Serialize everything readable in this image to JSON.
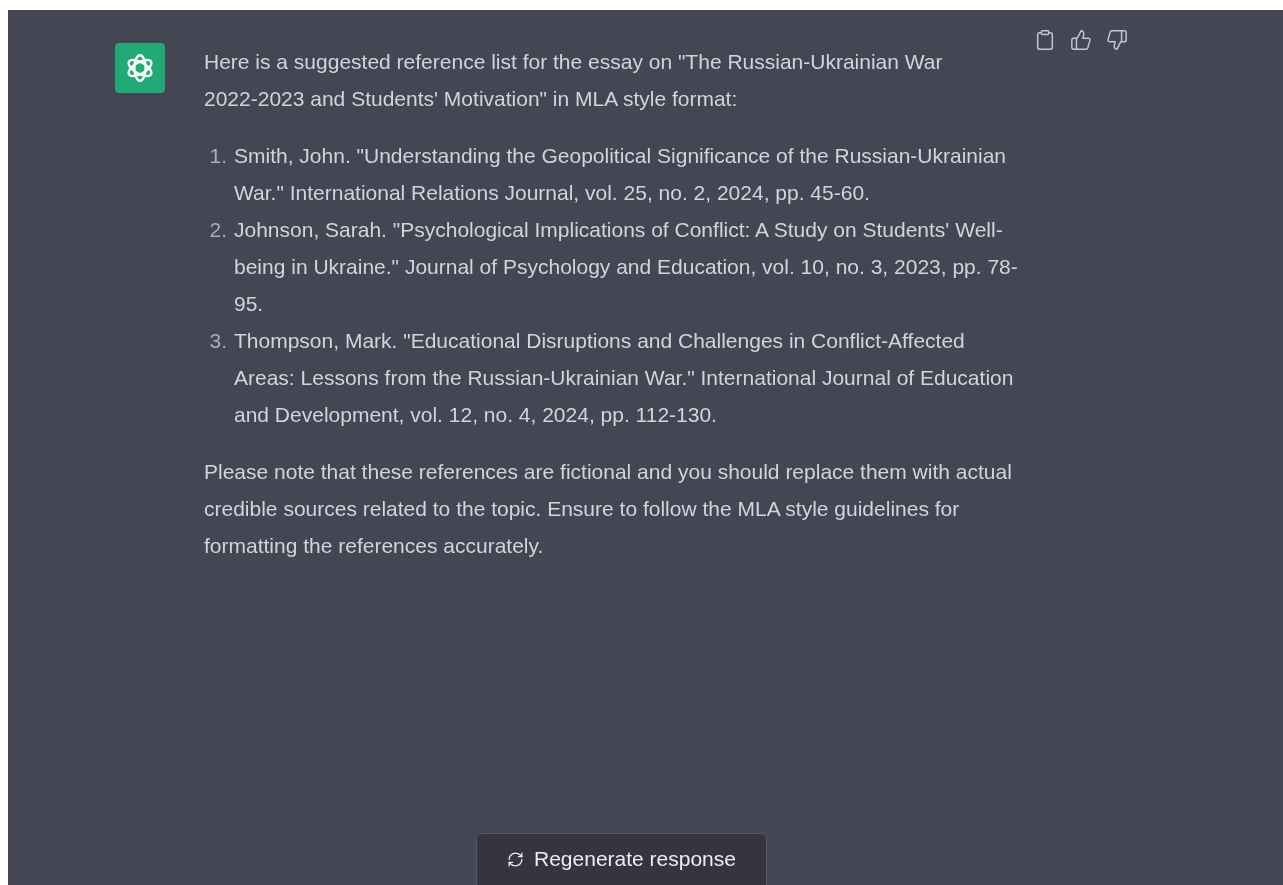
{
  "message": {
    "intro": "Here is a suggested reference list for the essay on \"The Russian-Ukrainian War 2022-2023 and Students' Motivation\" in MLA style format:",
    "references": [
      {
        "number": "1.",
        "text": "Smith, John. \"Understanding the Geopolitical Significance of the Russian-Ukrainian War.\" International Relations Journal, vol. 25, no. 2, 2024, pp. 45-60."
      },
      {
        "number": "2.",
        "text": "Johnson, Sarah. \"Psychological Implications of Conflict: A Study on Students' Well-being in Ukraine.\" Journal of Psychology and Education, vol. 10, no. 3, 2023, pp. 78-95."
      },
      {
        "number": "3.",
        "text": "Thompson, Mark. \"Educational Disruptions and Challenges in Conflict-Affected Areas: Lessons from the Russian-Ukrainian War.\" International Journal of Education and Development, vol. 12, no. 4, 2024, pp. 112-130."
      }
    ],
    "note": "Please note that these references are fictional and you should replace them with actual credible sources related to the topic. Ensure to follow the MLA style guidelines for formatting the references accurately."
  },
  "regenerate_button": {
    "label": "Regenerate response"
  }
}
